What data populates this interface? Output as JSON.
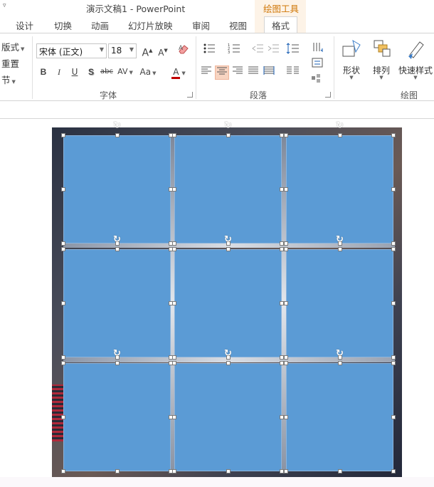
{
  "window": {
    "quick_access_arrow": "▿",
    "title": "演示文稿1 - PowerPoint",
    "context_tab_group": "绘图工具"
  },
  "tabs": [
    {
      "label": "设计",
      "active": false
    },
    {
      "label": "切换",
      "active": false
    },
    {
      "label": "动画",
      "active": false
    },
    {
      "label": "幻灯片放映",
      "active": false
    },
    {
      "label": "审阅",
      "active": false
    },
    {
      "label": "视图",
      "active": false
    },
    {
      "label": "格式",
      "active": true
    }
  ],
  "ribbon": {
    "slides_group": {
      "layout": "版式",
      "reset": "重置",
      "section": "节"
    },
    "font_group": {
      "label": "字体",
      "font_name": "宋体 (正文)",
      "font_size": "18",
      "grow": "A",
      "shrink": "A",
      "bold": "B",
      "italic": "I",
      "underline": "U",
      "shadow": "S",
      "strikethrough": "abc",
      "spacing": "AV",
      "change_case": "Aa",
      "font_color": "A",
      "font_color_value": "#c00000"
    },
    "paragraph_group": {
      "label": "段落"
    },
    "drawing_group": {
      "label": "绘图",
      "shapes": "形状",
      "arrange": "排列",
      "quick_styles": "快速样式"
    }
  },
  "colors": {
    "tile_fill": "#5b9bd5",
    "accent_orange": "#d0780a",
    "selected_align_bg": "#f8d4c1"
  },
  "slide": {
    "tiles": 9,
    "grid": "3x3"
  }
}
